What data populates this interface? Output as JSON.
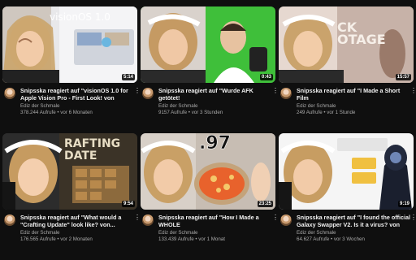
{
  "videos": [
    {
      "title": "Snipsska reagiert auf \"visionOS 1.0 for\nApple Vision Pro - First Look! von zollotech...",
      "channel": "Ediz der Schmale",
      "stats": "378.244 Aufrufe • vor 6 Monaten",
      "duration": "5:14",
      "overlay_text": "visionOS 1.0"
    },
    {
      "title": "Snipsska reagiert auf \"Wurde AFK getötet!\nHabe sie Alle vorher gewarnt! RACHE! von...",
      "channel": "Ediz der Schmale",
      "stats": "9157 Aufrufe • vor 3 Stunden",
      "duration": "0:43"
    },
    {
      "title": "Snipsska reagiert auf \"I Made a Short Film\nWith Stock Footage von ryancollinsvideo...",
      "channel": "Ediz der Schmale",
      "stats": "249 Aufrufe • vor 1 Stunde",
      "duration": "15:57",
      "overlay_text": "CK\nOTAGE"
    },
    {
      "title": "Snipsska reagiert auf \"What would a\n\"Crafting Update\" look like? von...",
      "channel": "Ediz der Schmale",
      "stats": "176.565 Aufrufe • vor 2 Monaten",
      "duration": "9:54",
      "overlay_text": "RAFTING\nDATE"
    },
    {
      "title": "Snipsska reagiert auf \"How I Made a WHOLE\nPizza for Under $1 von Charlie Anderson...",
      "channel": "Ediz der Schmale",
      "stats": "133.439 Aufrufe • vor 1 Monat",
      "duration": "23:25",
      "overlay_text": ".97"
    },
    {
      "title": "Snipsska reagiert auf \"I found the official\nGalaxy Swapper V2. Is it a virus? von Eric...",
      "channel": "Ediz der Schmale",
      "stats": "64.627 Aufrufe • vor 3 Wochen",
      "duration": "9:19"
    }
  ],
  "icons": {
    "more": "vertical-dots-icon",
    "avatar": "channel-avatar"
  },
  "colors": {
    "background": "#0f0f0f",
    "title": "#f1f1f1",
    "secondary": "#aaaaaa"
  }
}
